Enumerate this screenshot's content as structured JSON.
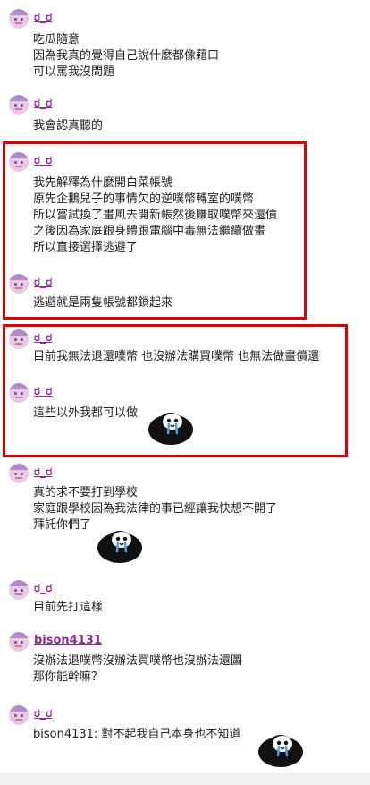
{
  "posts": [
    {
      "user": "ರ_ರ",
      "lines": [
        "吃瓜隨意",
        "因為我真的覺得自己說什麼都像藉口",
        "可以罵我沒問題"
      ]
    },
    {
      "user": "ರ_ರ",
      "lines": [
        "我會認真聽的"
      ]
    },
    {
      "user": "ರ_ರ",
      "lines": [
        "我先解釋為什麼開白菜帳號",
        "原先企鵝兒子的事情欠的逆噗幣轉室的噗幣",
        "所以嘗試換了畫風去開新帳然後賺取噗幣來還債",
        "之後因為家庭跟身體跟電腦中毒無法繼續做畫",
        "所以直接選擇逃避了"
      ]
    },
    {
      "user": "ರ_ರ",
      "lines": [
        "逃避就是兩隻帳號都鎖起來"
      ]
    },
    {
      "user": "ರ_ರ",
      "lines": [
        "目前我無法退還噗幣 也沒辦法購買噗幣 也無法做畫償還"
      ]
    },
    {
      "user": "ರ_ರ",
      "lines": [
        "這些以外我都可以做"
      ]
    },
    {
      "user": "ರ_ರ",
      "lines": [
        "真的求不要打到學校",
        "家庭跟學校因為我法律的事已經讓我快想不開了",
        "拜託你們了"
      ]
    },
    {
      "user": "ರ_ರ",
      "lines": [
        "目前先打這樣"
      ]
    },
    {
      "user": "bison4131",
      "lines": [
        "沒辦法退噗幣沒辦法買噗幣也沒辦法還圖",
        "那你能幹嘛？"
      ]
    },
    {
      "user": "ರ_ರ",
      "lines": [
        "bison4131: 對不起我自己本身也不知道"
      ]
    }
  ],
  "colors": {
    "username": "#8a2d8f",
    "highlight": "#e00000",
    "text": "#222222"
  }
}
